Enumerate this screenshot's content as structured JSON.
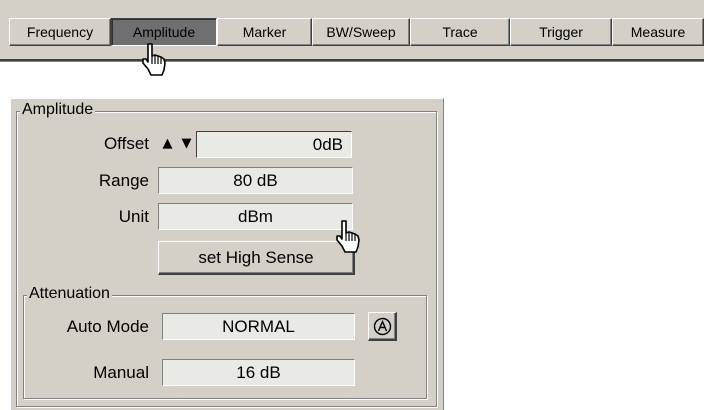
{
  "tabs": [
    {
      "label": "Frequency",
      "active": false
    },
    {
      "label": "Amplitude",
      "active": true
    },
    {
      "label": "Marker",
      "active": false
    },
    {
      "label": "BW/Sweep",
      "active": false
    },
    {
      "label": "Trace",
      "active": false
    },
    {
      "label": "Trigger",
      "active": false
    },
    {
      "label": "Measure",
      "active": false
    }
  ],
  "amplitude": {
    "group_title": "Amplitude",
    "offset": {
      "label": "Offset",
      "value": "0dB",
      "up_icon": "▲",
      "down_icon": "▼"
    },
    "range": {
      "label": "Range",
      "value": "80 dB"
    },
    "unit": {
      "label": "Unit",
      "value": "dBm"
    },
    "high_sense_button": "set High Sense"
  },
  "attenuation": {
    "group_title": "Attenuation",
    "auto_mode": {
      "label": "Auto Mode",
      "value": "NORMAL",
      "icon": "auto-a-icon"
    },
    "manual": {
      "label": "Manual",
      "value": "16 dB"
    }
  },
  "icons": {
    "cursor": "hand-pointer-icon",
    "auto": "circled-a-icon"
  },
  "colors": {
    "face": "#d4d0c8",
    "active_tab": "#6f6f6f",
    "field_bg": "#e9e9e6",
    "shadow": "#808080"
  }
}
